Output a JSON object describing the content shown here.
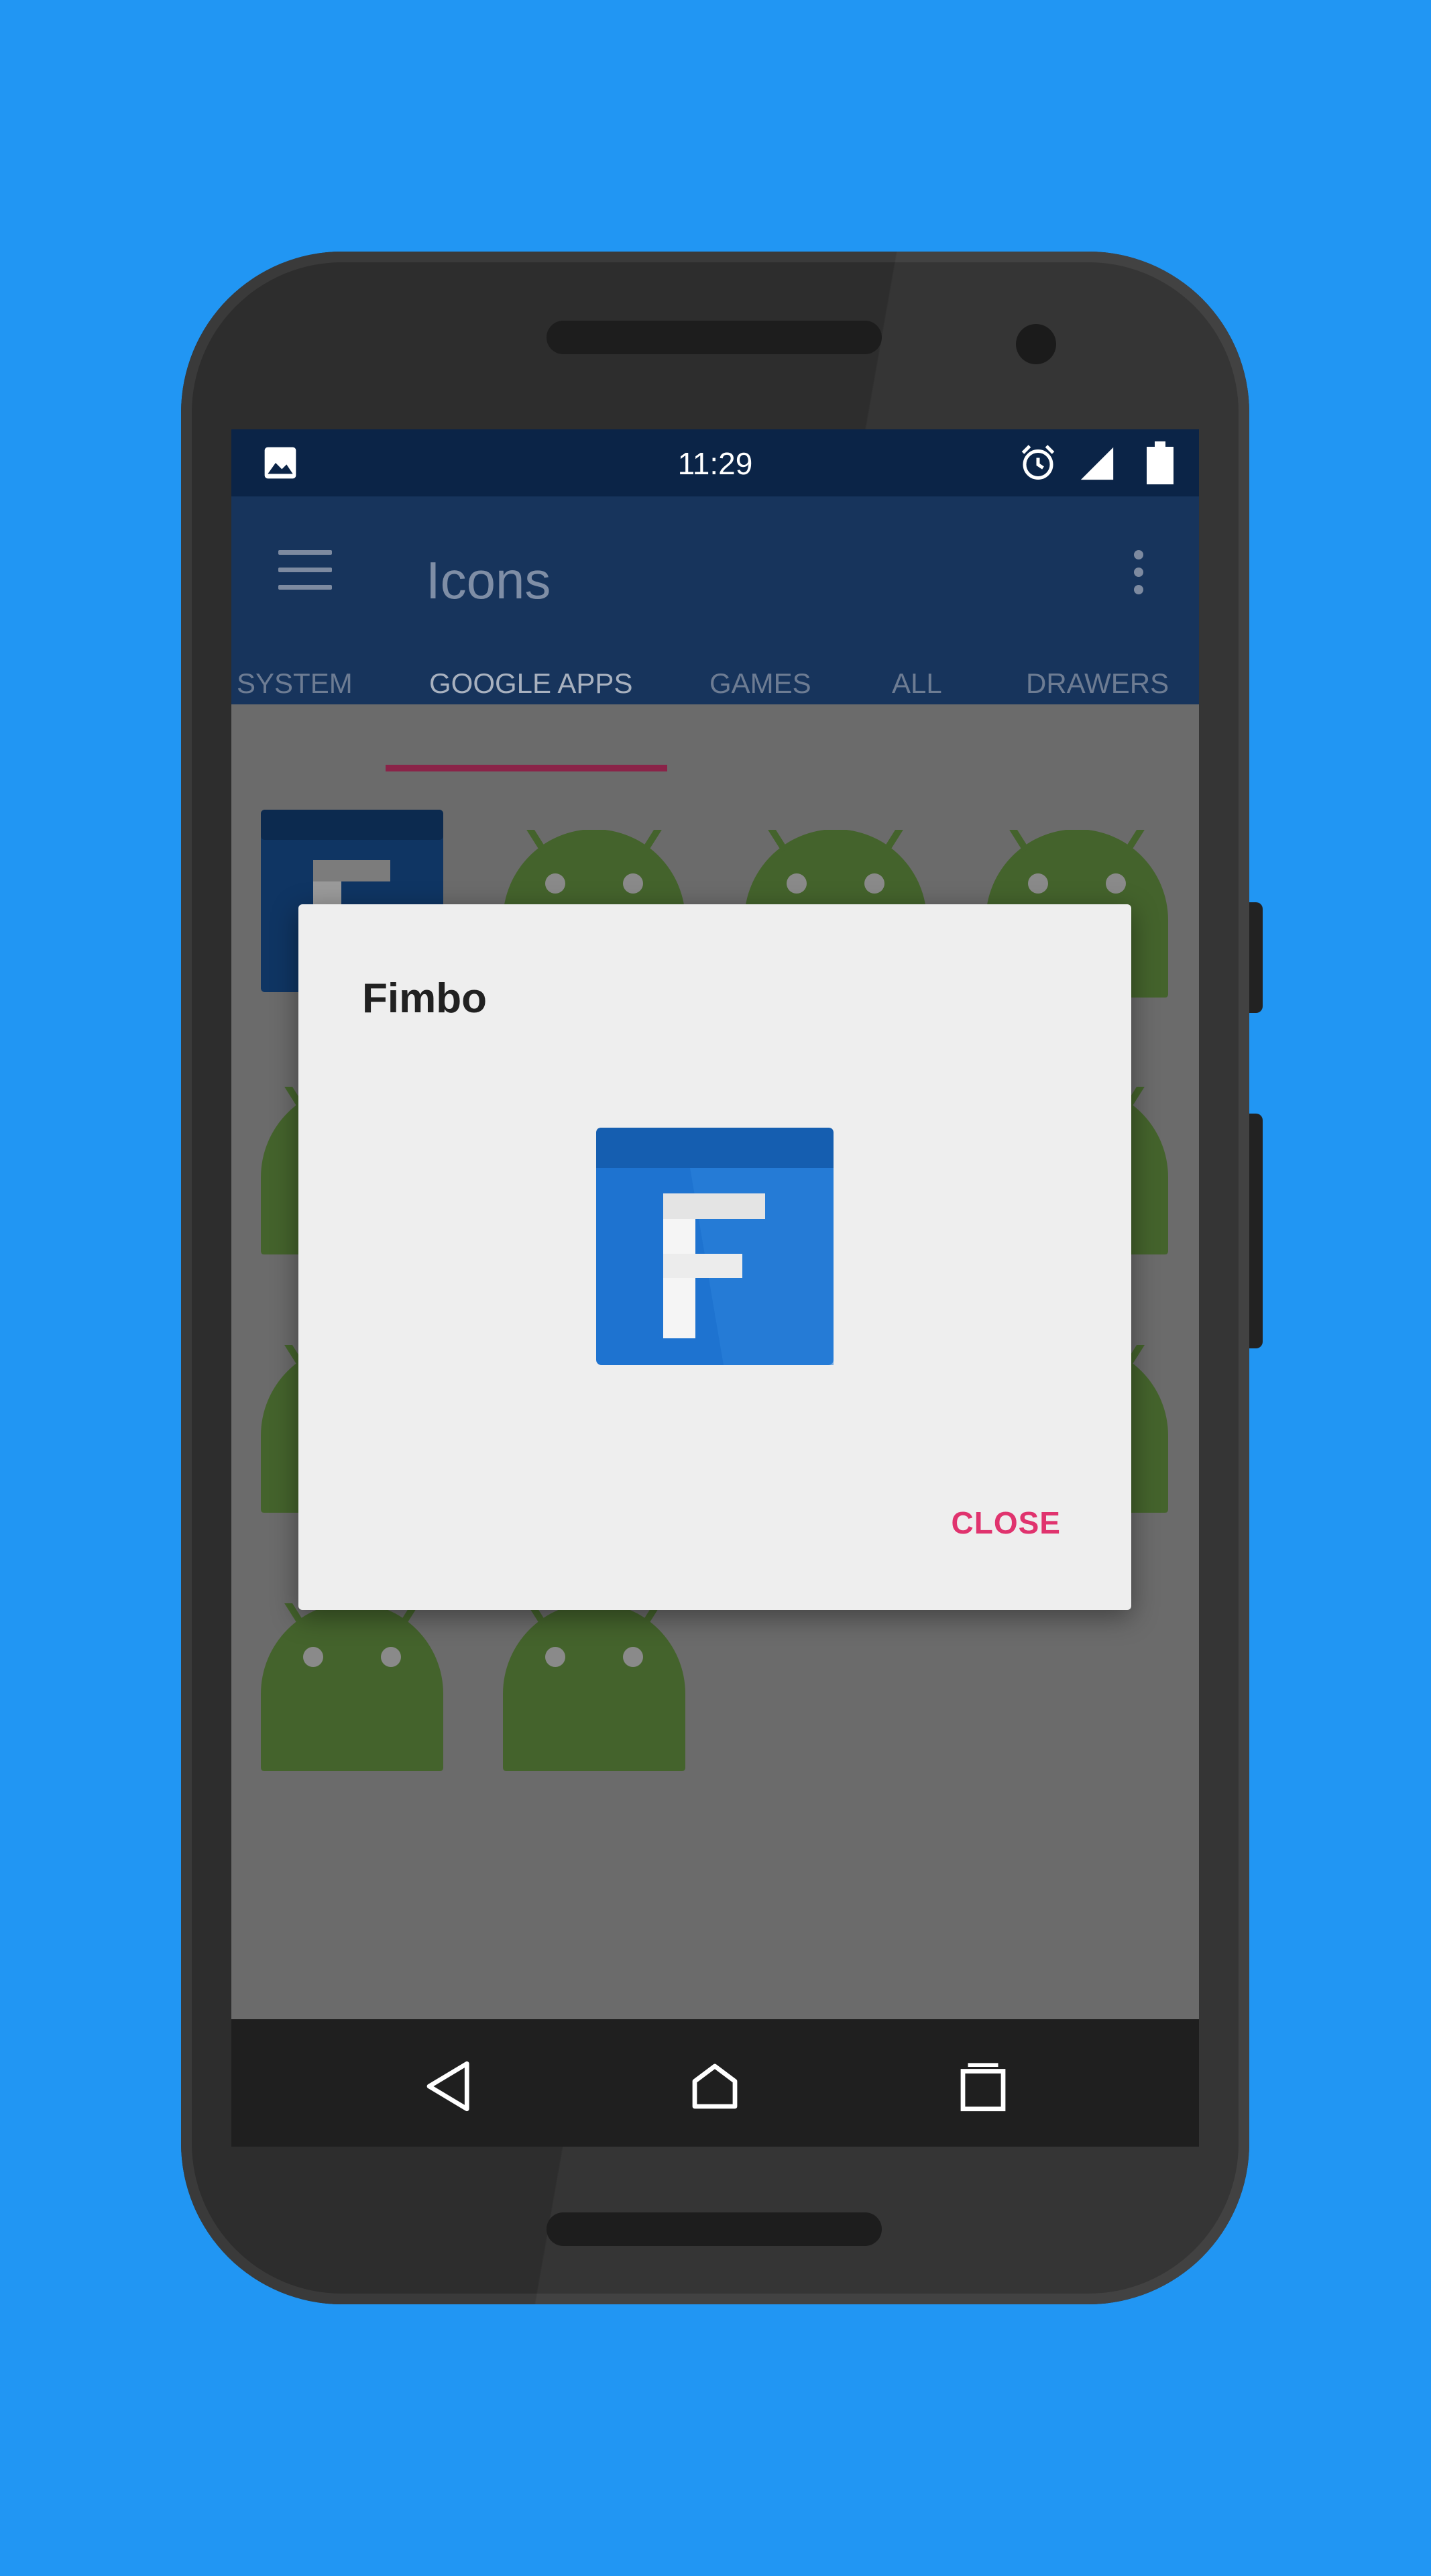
{
  "status_bar": {
    "time": "11:29",
    "left_icon": "image-icon",
    "right_icons": [
      "alarm-icon",
      "signal-icon",
      "battery-icon"
    ]
  },
  "app_bar": {
    "title": "Icons",
    "menu_icon": "hamburger-menu-icon",
    "overflow_icon": "more-vert-icon"
  },
  "tabs": [
    {
      "label": "SYSTEM",
      "active": false
    },
    {
      "label": "GOOGLE APPS",
      "active": true
    },
    {
      "label": "GAMES",
      "active": false
    },
    {
      "label": "ALL",
      "active": false
    },
    {
      "label": "DRAWERS",
      "active": false
    }
  ],
  "dialog": {
    "title": "Fimbo",
    "icon": "fimbo-app-icon",
    "close_label": "CLOSE"
  },
  "nav_bar": {
    "icons": [
      "back-icon",
      "home-icon",
      "recents-icon"
    ]
  },
  "colors": {
    "background": "#2196F3",
    "accent": "#E0336E",
    "app_bar": "#17345C",
    "status_bar": "#0B2447"
  }
}
